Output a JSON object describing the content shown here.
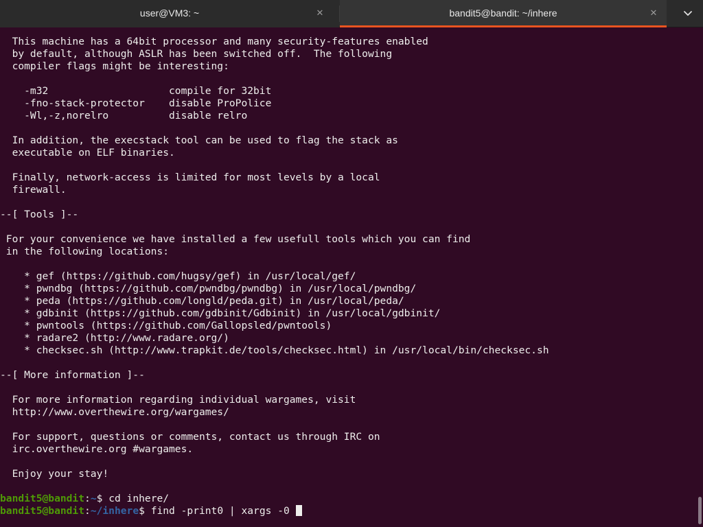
{
  "tabs": [
    {
      "title": "user@VM3: ~",
      "active": false
    },
    {
      "title": "bandit5@bandit: ~/inhere",
      "active": true
    }
  ],
  "colors": {
    "background": "#300a24",
    "accent": "#e95420",
    "prompt_user": "#4e9a06",
    "prompt_path": "#3465a4",
    "text": "#eeeeec"
  },
  "icons": {
    "tab_close": "close-icon",
    "menu": "chevron-down-icon"
  },
  "terminal": {
    "lines": [
      "  This machine has a 64bit processor and many security-features enabled",
      "  by default, although ASLR has been switched off.  The following",
      "  compiler flags might be interesting:",
      "",
      "    -m32                    compile for 32bit",
      "    -fno-stack-protector    disable ProPolice",
      "    -Wl,-z,norelro          disable relro",
      "",
      "  In addition, the execstack tool can be used to flag the stack as",
      "  executable on ELF binaries.",
      "",
      "  Finally, network-access is limited for most levels by a local",
      "  firewall.",
      "",
      "--[ Tools ]--",
      "",
      " For your convenience we have installed a few usefull tools which you can find",
      " in the following locations:",
      "",
      "    * gef (https://github.com/hugsy/gef) in /usr/local/gef/",
      "    * pwndbg (https://github.com/pwndbg/pwndbg) in /usr/local/pwndbg/",
      "    * peda (https://github.com/longld/peda.git) in /usr/local/peda/",
      "    * gdbinit (https://github.com/gdbinit/Gdbinit) in /usr/local/gdbinit/",
      "    * pwntools (https://github.com/Gallopsled/pwntools)",
      "    * radare2 (http://www.radare.org/)",
      "    * checksec.sh (http://www.trapkit.de/tools/checksec.html) in /usr/local/bin/checksec.sh",
      "",
      "--[ More information ]--",
      "",
      "  For more information regarding individual wargames, visit",
      "  http://www.overthewire.org/wargames/",
      "",
      "  For support, questions or comments, contact us through IRC on",
      "  irc.overthewire.org #wargames.",
      "",
      "  Enjoy your stay!",
      ""
    ],
    "prompts": [
      {
        "user": "bandit5@bandit",
        "sep": ":",
        "path": "~",
        "symbol": "$ ",
        "command": "cd inhere/"
      },
      {
        "user": "bandit5@bandit",
        "sep": ":",
        "path": "~/inhere",
        "symbol": "$ ",
        "command": "find -print0 | xargs -0 "
      }
    ]
  }
}
